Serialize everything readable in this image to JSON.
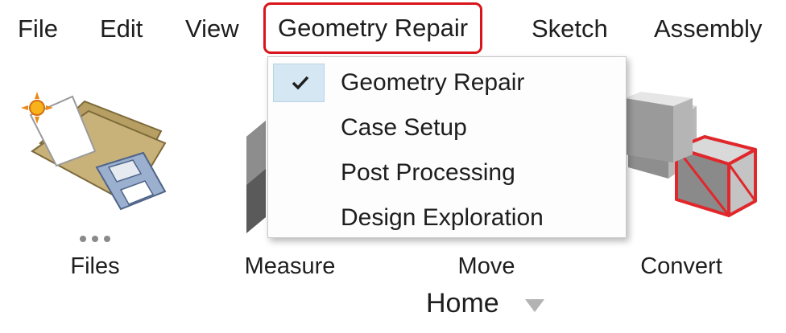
{
  "menubar": {
    "items": [
      "File",
      "Edit",
      "View",
      "Geometry Repair",
      "Sketch",
      "Assembly"
    ],
    "active": "Geometry Repair"
  },
  "dropdown": {
    "items": [
      {
        "label": "Geometry Repair",
        "checked": true
      },
      {
        "label": "Case Setup",
        "checked": false
      },
      {
        "label": "Post Processing",
        "checked": false
      },
      {
        "label": "Design Exploration",
        "checked": false
      }
    ]
  },
  "ribbon": {
    "tools": [
      {
        "label": "Files",
        "icon": "files-icon"
      },
      {
        "label": "Measure",
        "icon": "measure-icon"
      },
      {
        "label": "Move",
        "icon": "move-icon"
      },
      {
        "label": "Convert",
        "icon": "convert-icon"
      }
    ],
    "group_label": "Home",
    "overflow_icon": "more-dots-icon"
  },
  "colors": {
    "highlight_border": "#d9141b",
    "check_background": "#d4e7f2",
    "convert_accent": "#e0282c"
  }
}
